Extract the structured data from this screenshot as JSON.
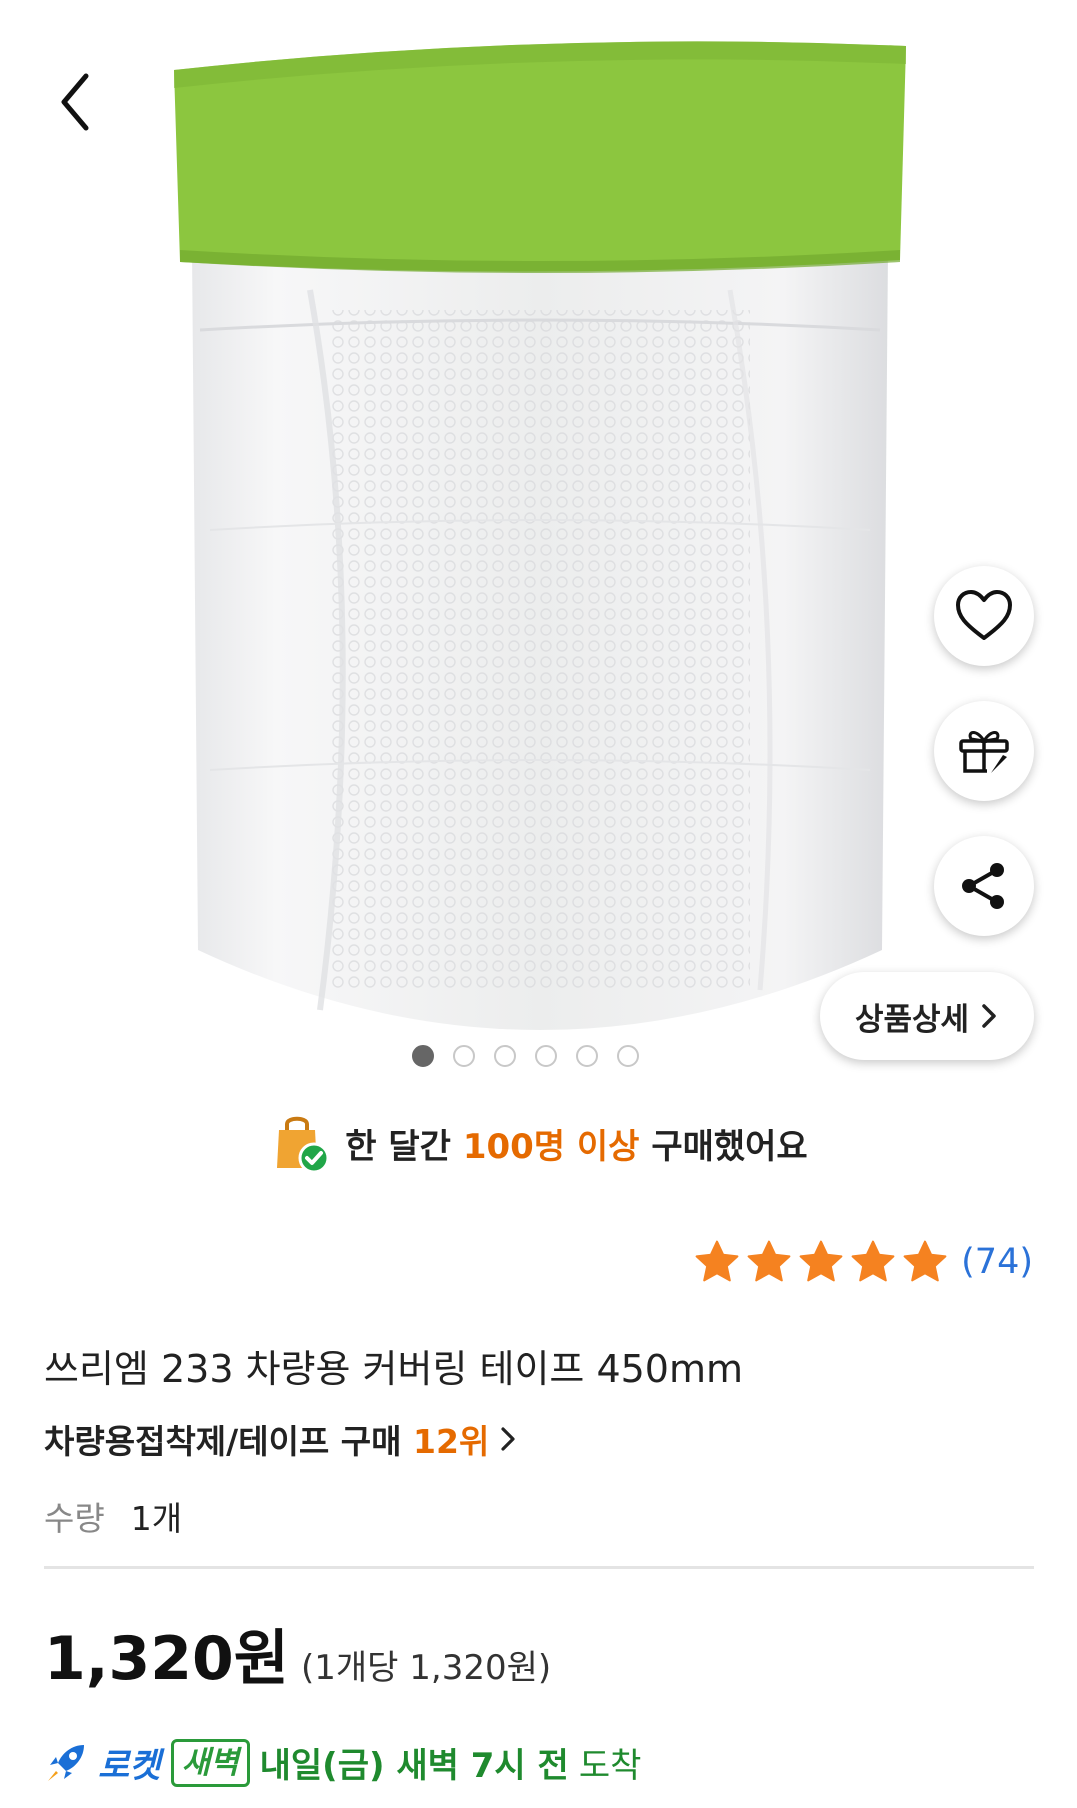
{
  "nav": {
    "back_icon": "chevron-left-icon"
  },
  "actions": {
    "wishlist_icon": "heart-icon",
    "gift_icon": "gift-icon",
    "share_icon": "share-icon",
    "detail_label": "상품상세",
    "detail_icon": "chevron-right-icon"
  },
  "gallery": {
    "total": 6,
    "active_index": 0
  },
  "purchase_banner": {
    "prefix": "한 달간",
    "highlight": "100명 이상",
    "suffix": "구매했어요"
  },
  "rating": {
    "stars": 5,
    "count": "(74)"
  },
  "product": {
    "title": "쓰리엠 233 차량용 커버링 테이프 450mm",
    "rank_category": "차량용접착제/테이프 구매",
    "rank_value": "12위",
    "quantity_label": "수량",
    "quantity_value": "1개"
  },
  "price": {
    "main": "1,320원",
    "unit_price": "(1개당 1,320원)"
  },
  "delivery": {
    "rocket_label": "로켓",
    "badge": "새벽",
    "eta": "내일(금) 새벽 7시 전",
    "eta_end": "도착"
  },
  "colors": {
    "accent_orange": "#e56a00",
    "rating_blue": "#2b72d8",
    "delivery_green": "#1f8a2e",
    "rocket_blue": "#1a6fd6"
  }
}
